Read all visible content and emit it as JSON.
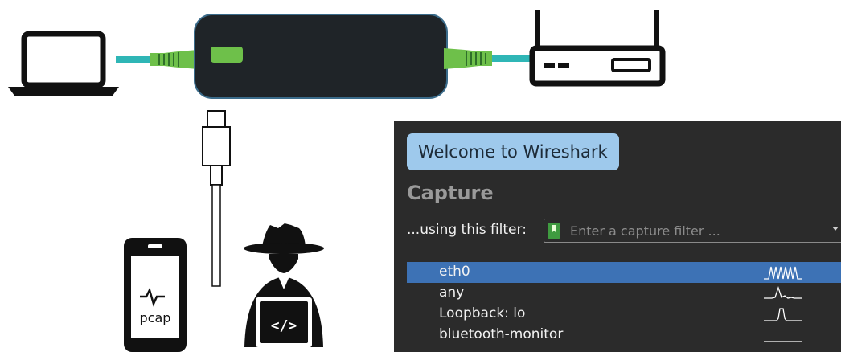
{
  "phone": {
    "label": "pcap"
  },
  "wireshark": {
    "welcome_label": "Welcome to Wireshark",
    "capture_heading": "Capture",
    "filter_label": "...using this filter:",
    "filter_placeholder": "Enter a capture filter ...",
    "interfaces": [
      {
        "name": "eth0",
        "selected": true
      },
      {
        "name": "any",
        "selected": false
      },
      {
        "name": "Loopback: lo",
        "selected": false
      },
      {
        "name": "bluetooth-monitor",
        "selected": false
      }
    ]
  },
  "colors": {
    "cable": "#2fb6b6",
    "connector": "#6ec04a",
    "device_led": "#6ec04a",
    "device_body": "#1f2428",
    "selection": "#3d72b5",
    "welcome_button": "#9ec9ec"
  }
}
